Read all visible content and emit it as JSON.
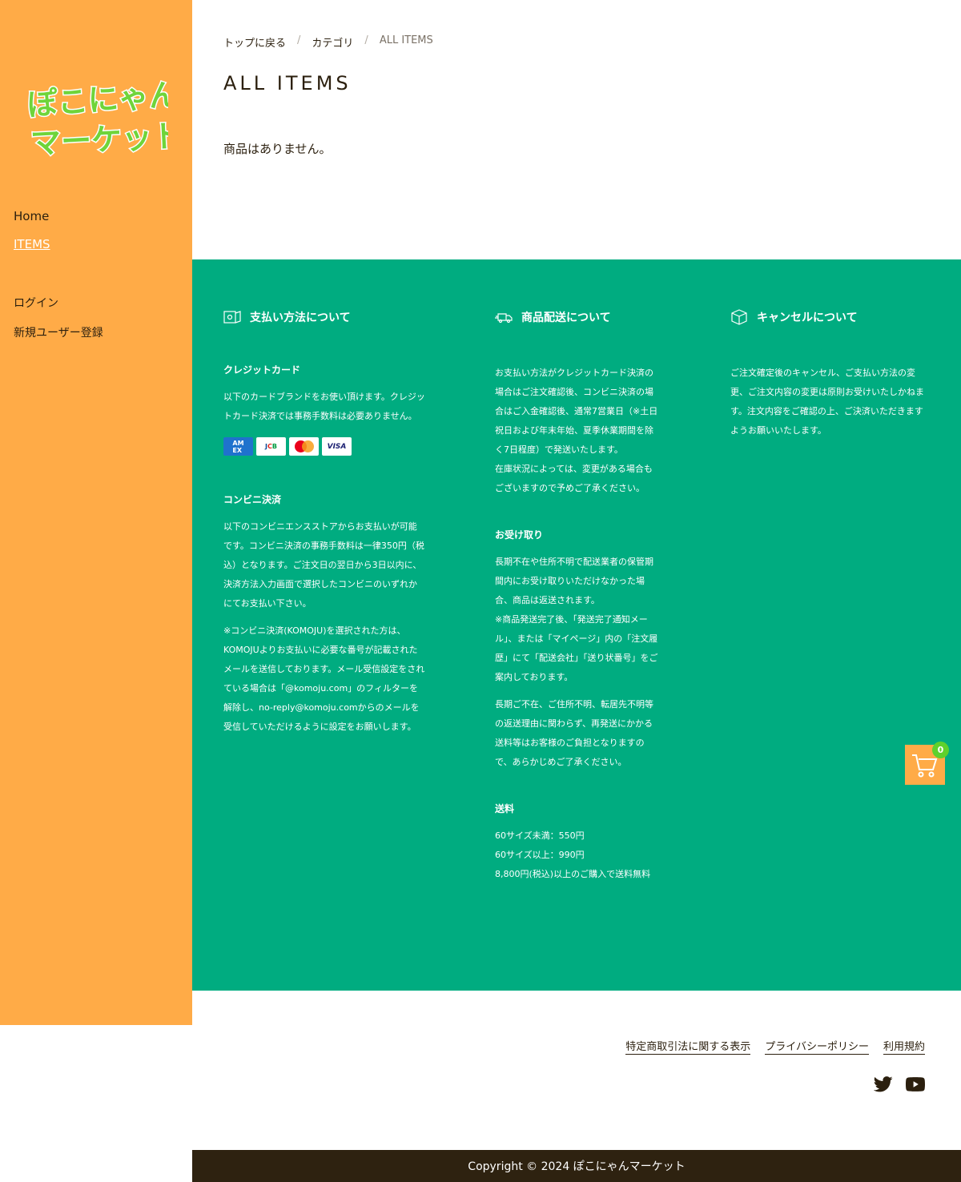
{
  "brand": {
    "logo_line1": "ぽこにゃん",
    "logo_line2": "マーケット",
    "accent": "#ffab47",
    "info_bg": "#00ac80",
    "dark": "#2e2210"
  },
  "nav": {
    "items": [
      {
        "label": "Home"
      },
      {
        "label": "ITEMS"
      }
    ],
    "account": [
      {
        "label": "ログイン"
      },
      {
        "label": "新規ユーザー登録"
      }
    ]
  },
  "breadcrumb": {
    "top": "トップに戻る",
    "category": "カテゴリ",
    "current": "ALL ITEMS",
    "sep": "/"
  },
  "main": {
    "title": "ALL ITEMS",
    "empty_message": "商品はありません。"
  },
  "info": {
    "payment": {
      "heading": "支払い方法について",
      "credit_heading": "クレジットカード",
      "credit_text": "以下のカードブランドをお使い頂けます。クレジットカード決済では事務手数料は必要ありません。",
      "cards": [
        "AMEX",
        "JCB",
        "Mastercard",
        "VISA"
      ],
      "conbini_heading": "コンビニ決済",
      "conbini_text1": "以下のコンビニエンスストアからお支払いが可能です。コンビニ決済の事務手数料は一律350円（税込）となります。ご注文日の翌日から3日以内に、決済方法入力画面で選択したコンビニのいずれかにてお支払い下さい。",
      "conbini_text2": "※コンビニ決済(KOMOJU)を選択された方は、KOMOJUよりお支払いに必要な番号が記載されたメールを送信しております。メール受信設定をされている場合は「@komoju.com」のフィルターを解除し、no-reply@komoju.comからのメールを受信していただけるように設定をお願いします。"
    },
    "shipping": {
      "heading": "商品配送について",
      "text1": "お支払い方法がクレジットカード決済の場合はご注文確認後、コンビニ決済の場合はご入金確認後、通常7営業日（※土日祝日および年末年始、夏季休業期間を除く7日程度）で発送いたします。",
      "text2": "在庫状況によっては、変更がある場合もございますので予めご了承ください。",
      "receive_heading": "お受け取り",
      "receive_text1": "長期不在や住所不明で配送業者の保管期間内にお受け取りいただけなかった場合、商品は返送されます。",
      "receive_text2": "※商品発送完了後、「発送完了通知メール」、または「マイページ」内の「注文履歴」にて「配送会社」「送り状番号」をご案内しております。",
      "receive_text3": "長期ご不在、ご住所不明、転居先不明等の返送理由に関わらず、再発送にかかる送料等はお客様のご負担となりますので、あらかじめご了承ください。",
      "fee_heading": "送料",
      "fee_line1": "60サイズ未満：550円",
      "fee_line2": "60サイズ以上：990円",
      "fee_line3": "8,800円(税込)以上のご購入で送料無料"
    },
    "cancel": {
      "heading": "キャンセルについて",
      "text": "ご注文確定後のキャンセル、ご支払い方法の変更、ご注文内容の変更は原則お受けいたしかねます。注文内容をご確認の上、ご決済いただきますようお願いいたします。"
    }
  },
  "footer": {
    "links": [
      {
        "label": "特定商取引法に関する表示"
      },
      {
        "label": "プライバシーポリシー"
      },
      {
        "label": "利用規約"
      }
    ],
    "social": [
      "twitter-icon",
      "youtube-icon"
    ],
    "copyright": "Copyright © 2024 ぽこにゃんマーケット"
  },
  "cart": {
    "count": "0"
  }
}
